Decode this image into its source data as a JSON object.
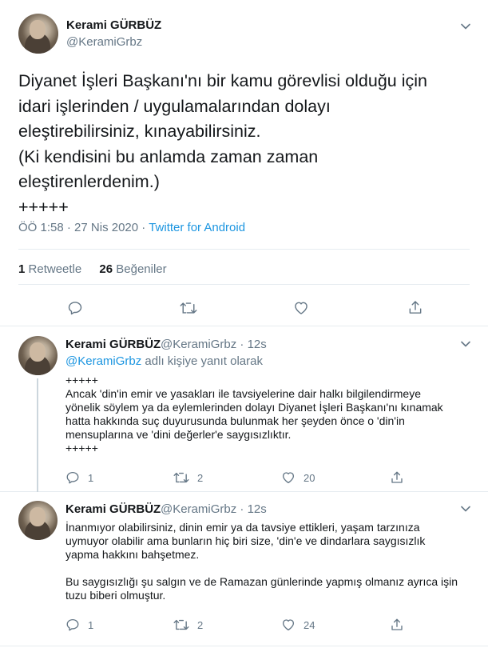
{
  "main_tweet": {
    "author_name": "Kerami GÜRBÜZ",
    "author_handle": "@KeramiGrbz",
    "text_lines": [
      "Diyanet İşleri Başkanı'nı bir kamu görevlisi olduğu için",
      "idari işlerinden / uygulamalarından dolayı",
      "eleştirebilirsiniz, kınayabilirsiniz.",
      "(Ki kendisini bu anlamda zaman zaman",
      "eleştirenlerdenim.)",
      "+++++"
    ],
    "time": "ÖÖ 1:58",
    "separator": "·",
    "date": "27 Nis 2020",
    "app": "Twitter for Android",
    "retweet_count": "1",
    "retweet_label": "Retweetle",
    "like_count": "26",
    "like_label": "Beğeniler"
  },
  "replies": [
    {
      "author_name": "Kerami GÜRBÜZ",
      "author_handle": "@KeramiGrbz",
      "separator": "·",
      "time": "12s",
      "reply_to_handle": "@KeramiGrbz",
      "reply_to_suffix": "adlı kişiye yanıt olarak",
      "text_lines": [
        "+++++",
        "Ancak 'din'in emir ve yasakları ile tavsiyelerine dair halkı bilgilendirmeye",
        "yönelik söylem ya da eylemlerinden dolayı Diyanet İşleri Başkanı'nı kınamak",
        "hatta hakkında suç duyurusunda bulunmak her şeyden önce o 'din'in",
        "mensuplarına ve 'dini değerler'e saygısızlıktır.",
        "+++++"
      ],
      "reply_count": "1",
      "retweet_count": "2",
      "like_count": "20"
    },
    {
      "author_name": "Kerami GÜRBÜZ",
      "author_handle": "@KeramiGrbz",
      "separator": "·",
      "time": "12s",
      "text_lines": [
        "İnanmıyor olabilirsiniz, dinin emir ya da tavsiye ettikleri, yaşam tarzınıza",
        "uymuyor olabilir ama bunların hiç biri size, 'din'e ve dindarlara saygısızlık",
        "yapma hakkını bahşetmez.",
        "",
        "Bu saygısızlığı şu salgın ve de Ramazan günlerinde yapmış olmanız ayrıca işin",
        "tuzu biberi olmuştur."
      ],
      "reply_count": "1",
      "retweet_count": "2",
      "like_count": "24"
    }
  ],
  "icons": {
    "reply": "reply-icon",
    "retweet": "retweet-icon",
    "like": "heart-icon",
    "share": "share-icon",
    "menu": "chevron-down-icon"
  },
  "colors": {
    "text": "#14171a",
    "secondary": "#657786",
    "link": "#1b95e0",
    "divider": "#e6ecf0"
  }
}
